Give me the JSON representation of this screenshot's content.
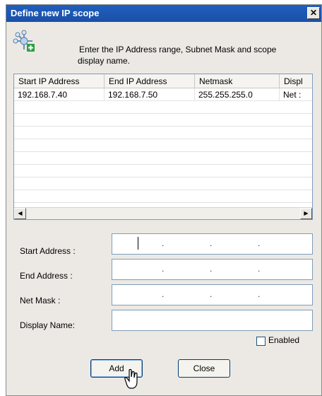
{
  "window": {
    "title": "Define new IP scope",
    "close_glyph": "✕"
  },
  "header": {
    "icon": "network-add-icon",
    "text": "Enter the IP Address range, Subnet Mask and scope display name."
  },
  "list": {
    "columns": [
      "Start IP Address",
      "End IP Address",
      "Netmask",
      "Displ"
    ],
    "rows": [
      [
        "192.168.7.40",
        "192.168.7.50",
        "255.255.255.0",
        "Net :"
      ]
    ],
    "scroll_left": "◀",
    "scroll_right": "▶"
  },
  "form": {
    "start_address_label": "Start Address :",
    "end_address_label": "End Address :",
    "net_mask_label": "Net Mask :",
    "display_name_label": "Display Name:",
    "display_name_value": "",
    "enabled_label": "Enabled",
    "enabled_checked": false
  },
  "buttons": {
    "add_label": "Add",
    "close_label": "Close"
  },
  "colors": {
    "titlebar": "#1f5fbf",
    "dialog": "#ece9e4",
    "border": "#7f9db9"
  }
}
